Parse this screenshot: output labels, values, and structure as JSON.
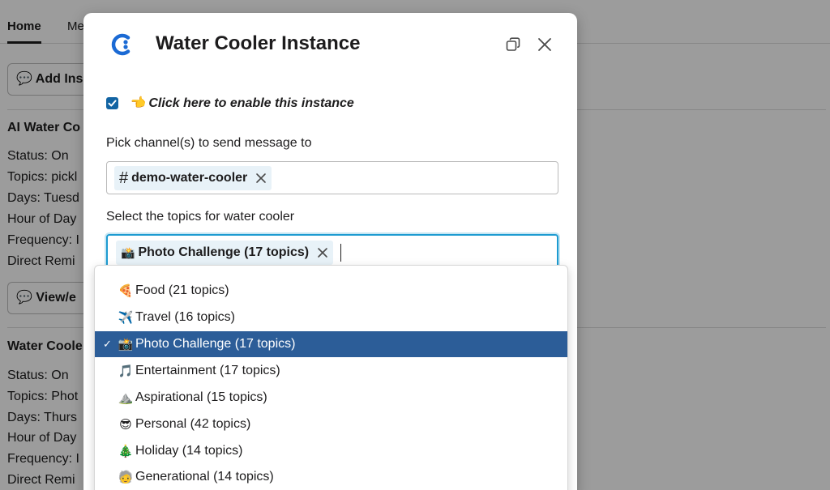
{
  "background": {
    "tabs": [
      {
        "label": "Home",
        "active": true
      },
      {
        "label": "Me",
        "active": false
      }
    ],
    "add_button_label": "Add Ins",
    "view_button_label": "View/e",
    "sections": [
      {
        "heading": "AI Water Co",
        "lines": [
          "Status: On",
          "Topics: pickl",
          "Days: Tuesd",
          "Hour of Day",
          "Frequency: I",
          "Direct Remi"
        ]
      },
      {
        "heading": "Water Coole",
        "lines": [
          "Status: On",
          "Topics: Phot",
          "Days: Thurs",
          "Hour of Day",
          "Frequency: I",
          "Direct Remi"
        ]
      }
    ]
  },
  "modal": {
    "title": "Water Cooler Instance",
    "logo_icon": "c-logo-icon",
    "enable_checkbox": {
      "checked": true,
      "emoji": "👈",
      "label": "Click here to enable this instance"
    },
    "channel_field": {
      "label": "Pick channel(s) to send message to",
      "chips": [
        {
          "prefix": "#",
          "text": "demo-water-cooler"
        }
      ]
    },
    "topics_field": {
      "label": "Select the topics for water cooler",
      "chips": [
        {
          "emoji": "📸",
          "text": "Photo Challenge (17 topics)"
        }
      ]
    }
  },
  "dropdown": {
    "options": [
      {
        "emoji": "🍕",
        "label": "Food (21 topics)",
        "selected": false
      },
      {
        "emoji": "✈️",
        "label": "Travel (16 topics)",
        "selected": false
      },
      {
        "emoji": "📸",
        "label": "Photo Challenge (17 topics)",
        "selected": true
      },
      {
        "emoji": "🎵",
        "label": "Entertainment (17 topics)",
        "selected": false
      },
      {
        "emoji": "⛰️",
        "label": "Aspirational (15 topics)",
        "selected": false
      },
      {
        "emoji": "😎",
        "label": "Personal (42 topics)",
        "selected": false
      },
      {
        "emoji": "🎄",
        "label": "Holiday (14 topics)",
        "selected": false
      },
      {
        "emoji": "🧓",
        "label": "Generational (14 topics)",
        "selected": false
      }
    ],
    "check_mark": "✓"
  },
  "colors": {
    "selected_option": "#2c5d98",
    "focus_border": "#1d9bd1",
    "checkbox": "#1264a3",
    "chip_bg": "#e8f2f8",
    "logo": "#1b6ad4"
  }
}
